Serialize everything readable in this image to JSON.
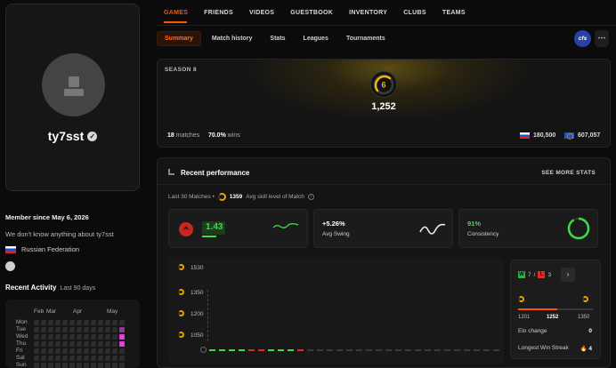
{
  "profile": {
    "username": "ty7sst",
    "member_since": "Member since May 6, 2026",
    "bio": "We don't know anything about ty7sst",
    "country": "Russian Federation"
  },
  "activity": {
    "title": "Recent Activity",
    "subtitle": "Last 90 days",
    "months": [
      "Feb",
      "Mar",
      "Apr",
      "May"
    ],
    "days": [
      "Mon",
      "Tue",
      "Wed",
      "Thu",
      "Fri",
      "Sat",
      "Sun"
    ],
    "active_color": "#e040e0"
  },
  "nav": {
    "items": [
      "GAMES",
      "FRIENDS",
      "VIDEOS",
      "GUESTBOOK",
      "INVENTORY",
      "CLUBS",
      "TEAMS"
    ],
    "active": "GAMES",
    "accent": "#ff5500"
  },
  "subnav": {
    "items": [
      "Summary",
      "Match history",
      "Stats",
      "Leagues",
      "Tournaments"
    ],
    "active": "Summary",
    "team_tag": "cfs",
    "more": "⋯"
  },
  "season": {
    "label": "SEASON 8",
    "level": "6",
    "elo": "1,252",
    "matches": "18",
    "matches_label": "matches",
    "winrate": "70.0%",
    "wins_label": "wins",
    "country_rank": "180,500",
    "region_rank": "607,057"
  },
  "performance": {
    "title": "Recent performance",
    "see_more": "SEE MORE STATS",
    "sub_prefix": "Last 30 Matches •",
    "avg_level": "1359",
    "avg_level_label": "Avg skill level of Match",
    "kd": "1.43",
    "avg_swing": "+5.26%",
    "avg_swing_label": "Avg Swing",
    "consistency": "91%",
    "consistency_label": "Consistency",
    "y_ticks": [
      "1530",
      "1350",
      "1200",
      "1050"
    ]
  },
  "elo_card": {
    "wins": "7",
    "losses": "3",
    "arrow": "›",
    "min": "1201",
    "current": "1252",
    "max": "1350",
    "current_fraction": 0.52,
    "elo_change_label": "Elo change",
    "elo_change": "0",
    "streak_label": "Longest Win Streak",
    "streak": "4"
  }
}
